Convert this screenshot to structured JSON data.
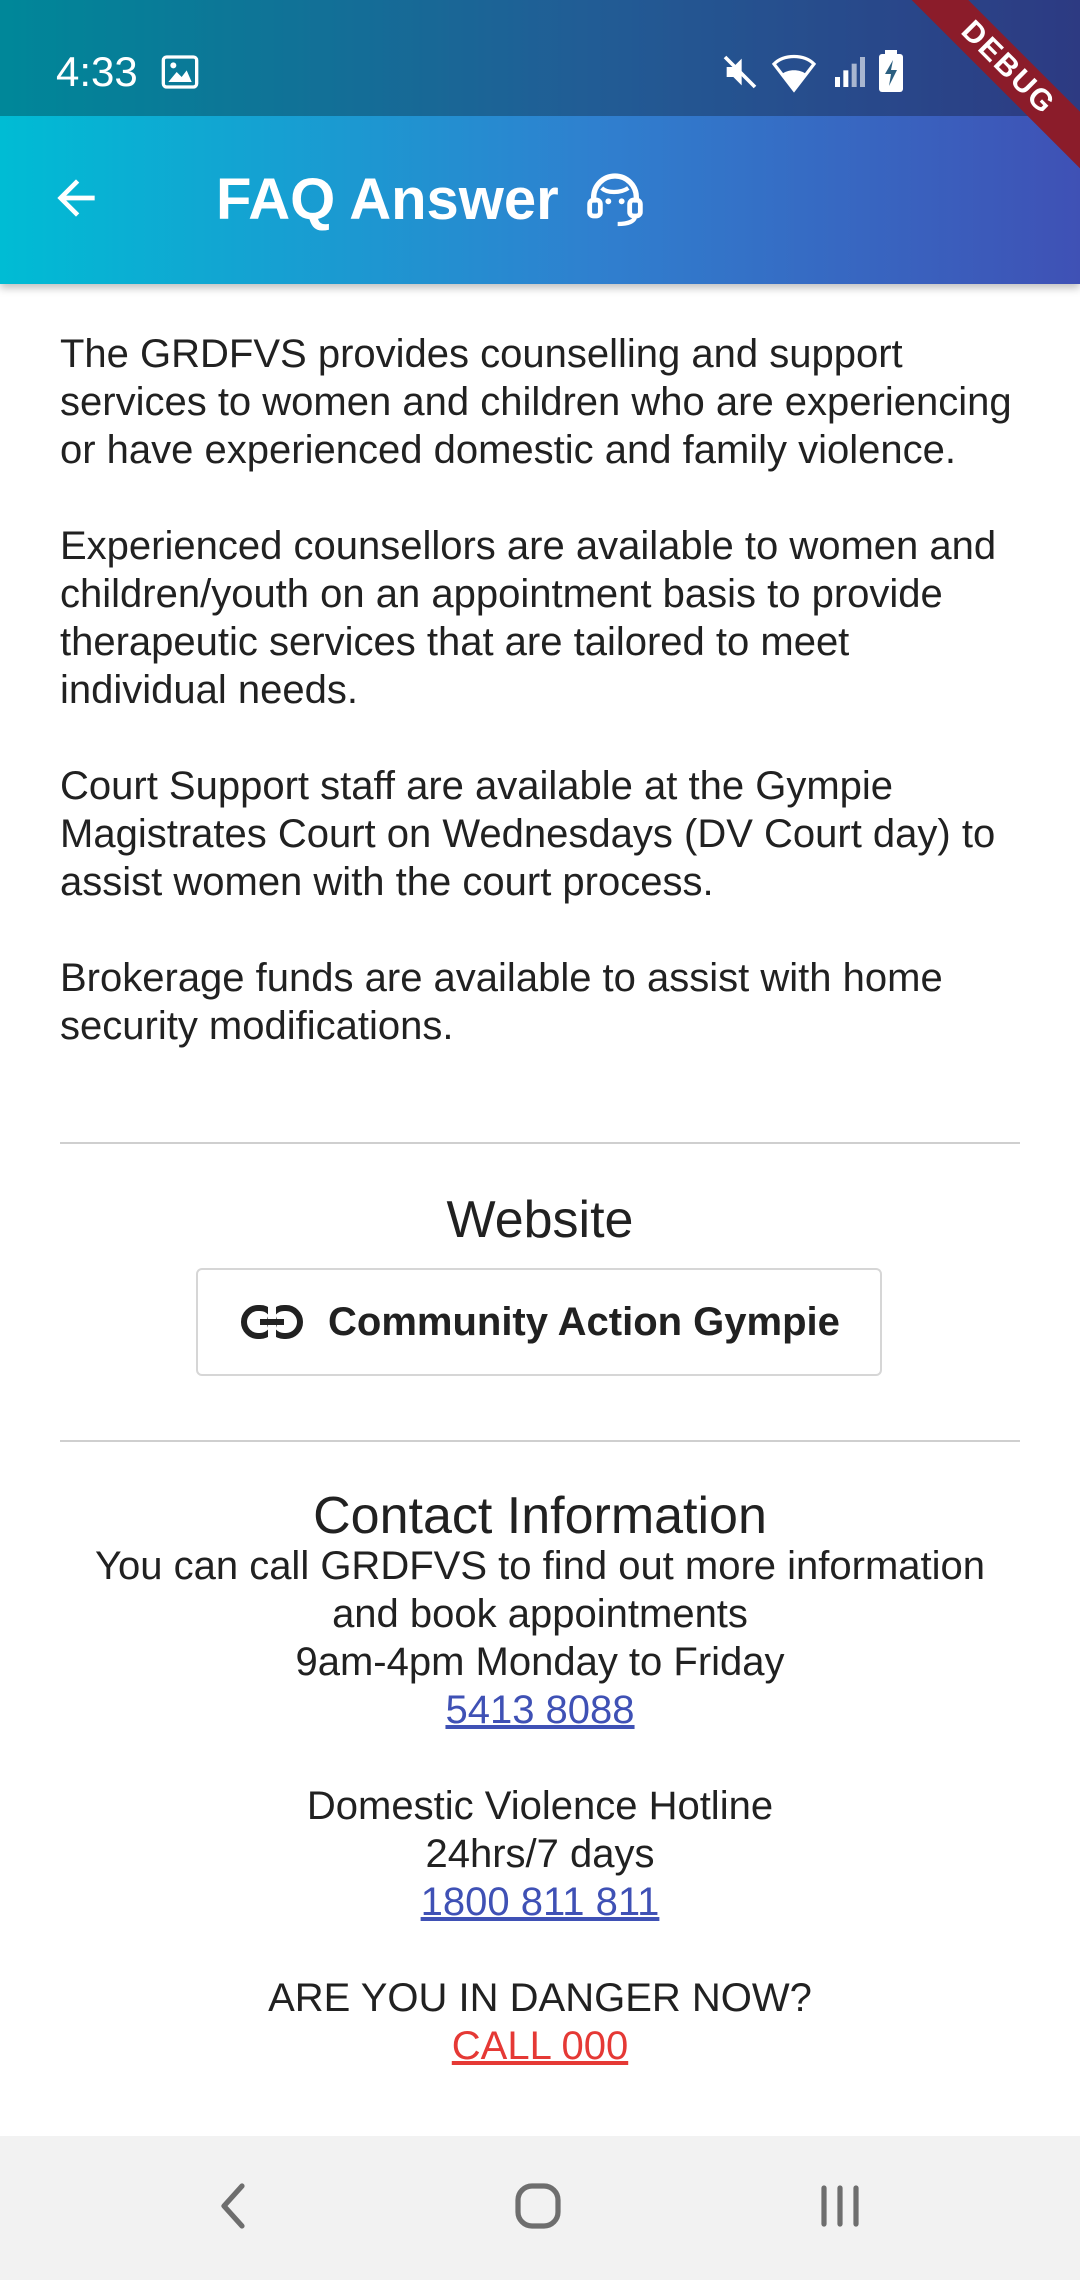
{
  "status_bar": {
    "time": "4:33",
    "icons": [
      "image-icon",
      "mute-icon",
      "wifi-icon",
      "signal-icon",
      "battery-charging-icon"
    ]
  },
  "debug_banner": "DEBUG",
  "app_bar": {
    "title": "FAQ Answer",
    "back_icon": "arrow-back-icon",
    "title_icon": "headset-support-icon",
    "gradient_start": "#00bcd4",
    "gradient_end": "#3f51b5"
  },
  "body_paragraphs": [
    "The GRDFVS provides counselling and support services to women and children who are experiencing or have experienced domestic and family violence.",
    "Experienced counsellors are available to women and children/youth on an appointment basis to provide therapeutic services that are tailored to meet individual needs.",
    "Court Support staff are available at the Gympie Magistrates Court on Wednesdays (DV Court day) to assist women with the court process.",
    "Brokerage funds are available to assist with home security modifications."
  ],
  "website": {
    "heading": "Website",
    "button_label": "Community Action Gympie",
    "button_icon": "link-icon"
  },
  "contact": {
    "heading": "Contact Information",
    "line1": "You can call GRDFVS to find out more information",
    "line2": "and book appointments",
    "hours": "9am-4pm Monday to Friday",
    "phone": "5413 8088",
    "hotline_title": "Domestic Violence Hotline",
    "hotline_hours": "24hrs/7 days",
    "hotline_phone": "1800 811 811",
    "danger_question": "ARE YOU IN DANGER NOW?",
    "danger_call": "CALL 000",
    "link_color": "#3f51b5",
    "danger_color": "#e53935"
  },
  "nav_bar": {
    "back_icon": "nav-back-icon",
    "home_icon": "nav-home-icon",
    "recents_icon": "nav-recents-icon"
  }
}
